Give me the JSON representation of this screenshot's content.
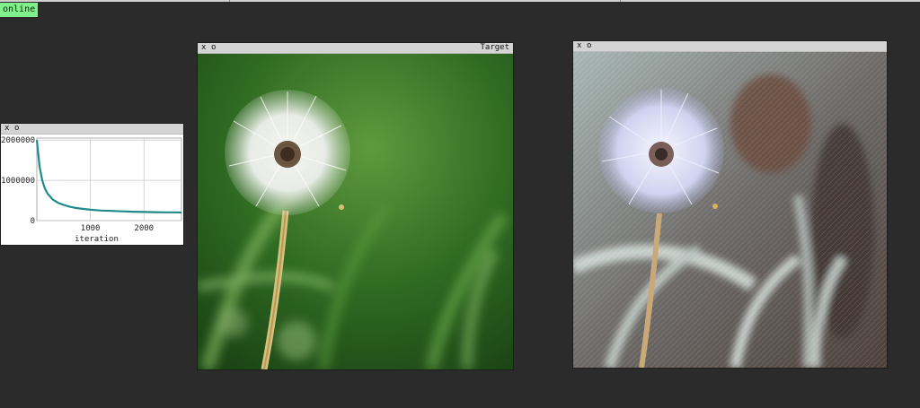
{
  "status": {
    "label": "online"
  },
  "chart_window": {
    "close_label": "x",
    "minimize_label": "o",
    "chart_data": {
      "type": "line",
      "xlabel": "iteration",
      "ylabel": "",
      "xlim": [
        0,
        2700
      ],
      "ylim": [
        0,
        2050000
      ],
      "xticks": [
        1000,
        2000
      ],
      "xtick_labels": [
        "1000",
        "2000"
      ],
      "yticks": [
        0,
        1000000,
        2000000
      ],
      "ytick_labels": [
        "0",
        "1000000",
        "2000000"
      ],
      "grid": true,
      "series": [
        {
          "color": "#1f8a8a",
          "x": [
            0,
            50,
            100,
            150,
            200,
            300,
            400,
            500,
            600,
            700,
            800,
            1000,
            1200,
            1400,
            1600,
            1800,
            2000,
            2200,
            2400,
            2600,
            2700
          ],
          "y": [
            2000000,
            1350000,
            1000000,
            800000,
            670000,
            520000,
            440000,
            390000,
            350000,
            320000,
            300000,
            270000,
            250000,
            240000,
            230000,
            220000,
            215000,
            210000,
            205000,
            205000,
            200000
          ]
        }
      ]
    }
  },
  "target_window": {
    "close_label": "x",
    "minimize_label": "o",
    "title": "Target",
    "image": "dandelion-photo"
  },
  "output_window": {
    "close_label": "x",
    "minimize_label": "o",
    "image": "stylized-dandelion"
  }
}
